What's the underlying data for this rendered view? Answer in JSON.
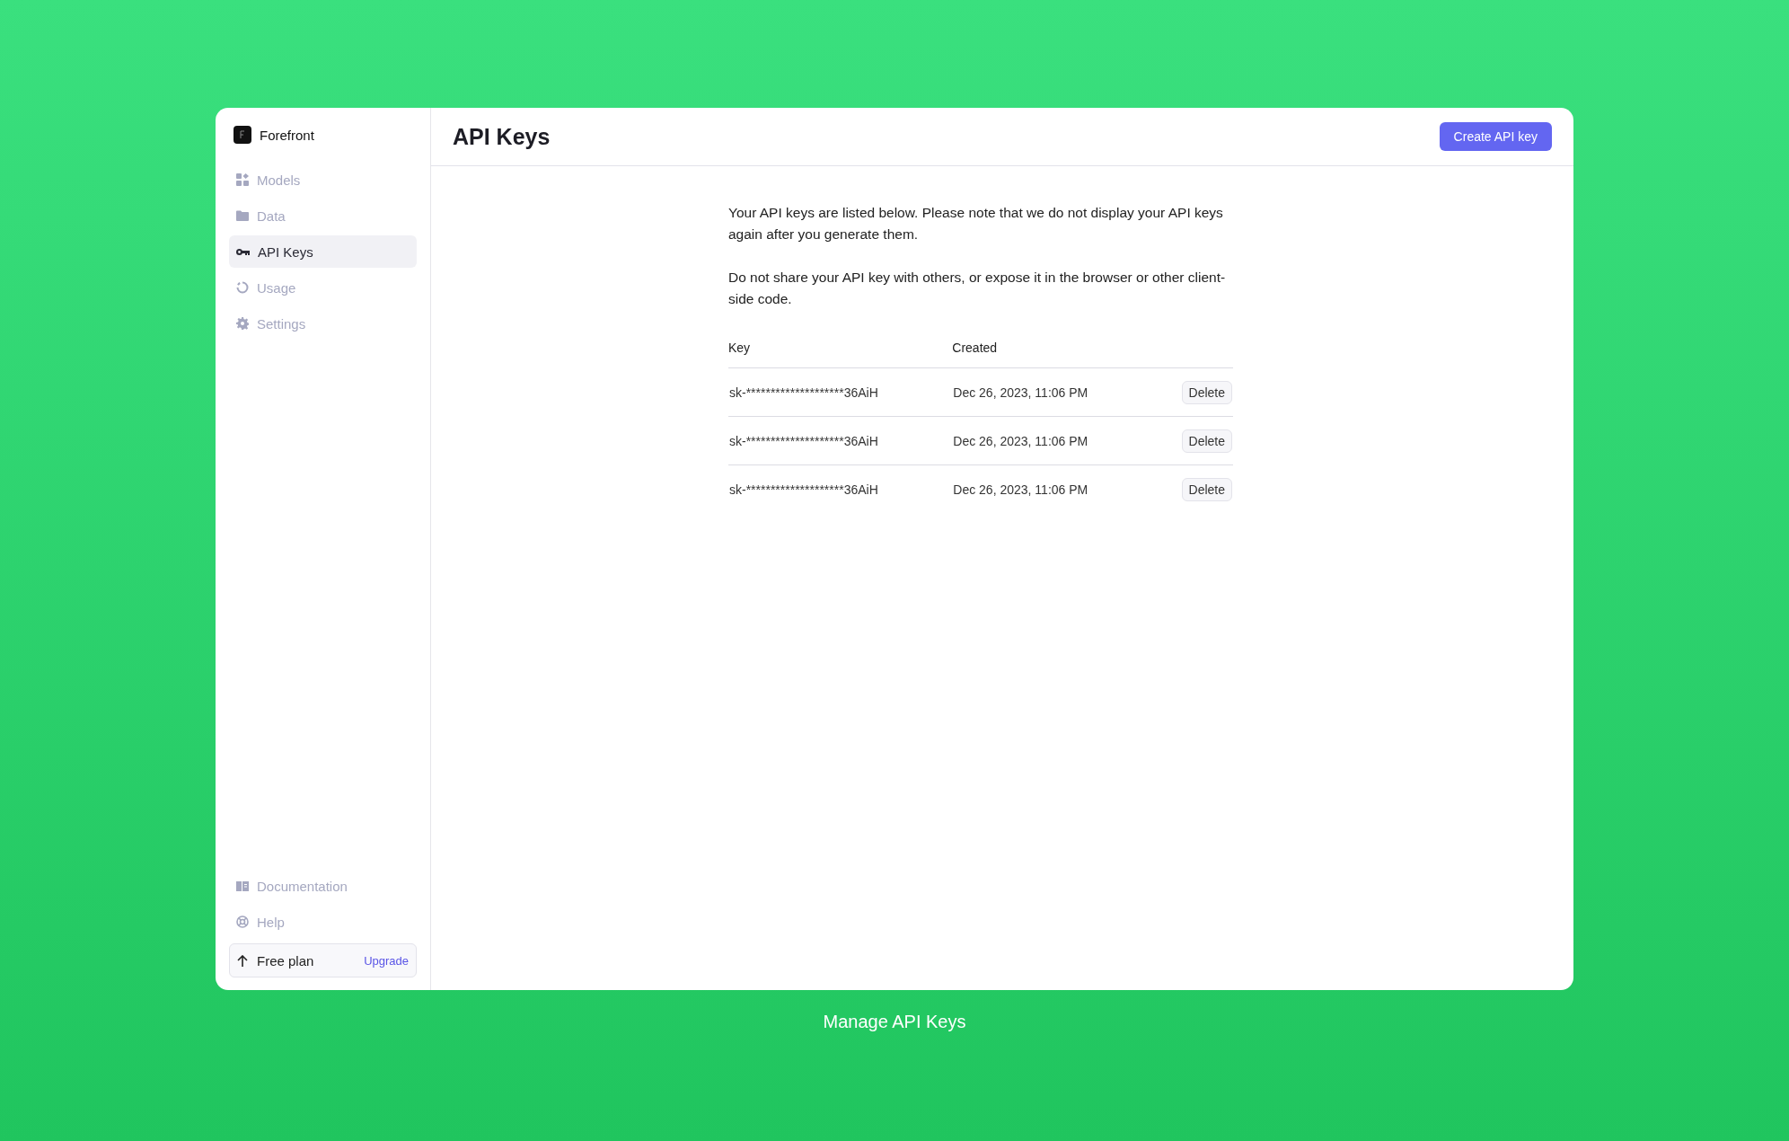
{
  "sidebar": {
    "brand": "Forefront",
    "nav": [
      {
        "label": "Models",
        "selected": false
      },
      {
        "label": "Data",
        "selected": false
      },
      {
        "label": "API Keys",
        "selected": true
      },
      {
        "label": "Usage",
        "selected": false
      },
      {
        "label": "Settings",
        "selected": false
      }
    ],
    "footer_links": [
      {
        "label": "Documentation"
      },
      {
        "label": "Help"
      }
    ],
    "plan": {
      "label": "Free plan",
      "action": "Upgrade"
    }
  },
  "header": {
    "title": "API Keys",
    "button": "Create API key"
  },
  "intro": [
    "Your API keys are listed below. Please note that we do not display your API keys again after you generate them.",
    "Do not share your API key with others, or expose it in the browser or other client-side code."
  ],
  "table": {
    "columns": [
      "Key",
      "Created"
    ],
    "rows": [
      {
        "key": "sk-********************36AiH",
        "created": "Dec 26, 2023, 11:06 PM",
        "action": "Delete"
      },
      {
        "key": "sk-********************36AiH",
        "created": "Dec 26, 2023, 11:06 PM",
        "action": "Delete"
      },
      {
        "key": "sk-********************36AiH",
        "created": "Dec 26, 2023, 11:06 PM",
        "action": "Delete"
      }
    ]
  },
  "caption": "Manage API Keys"
}
